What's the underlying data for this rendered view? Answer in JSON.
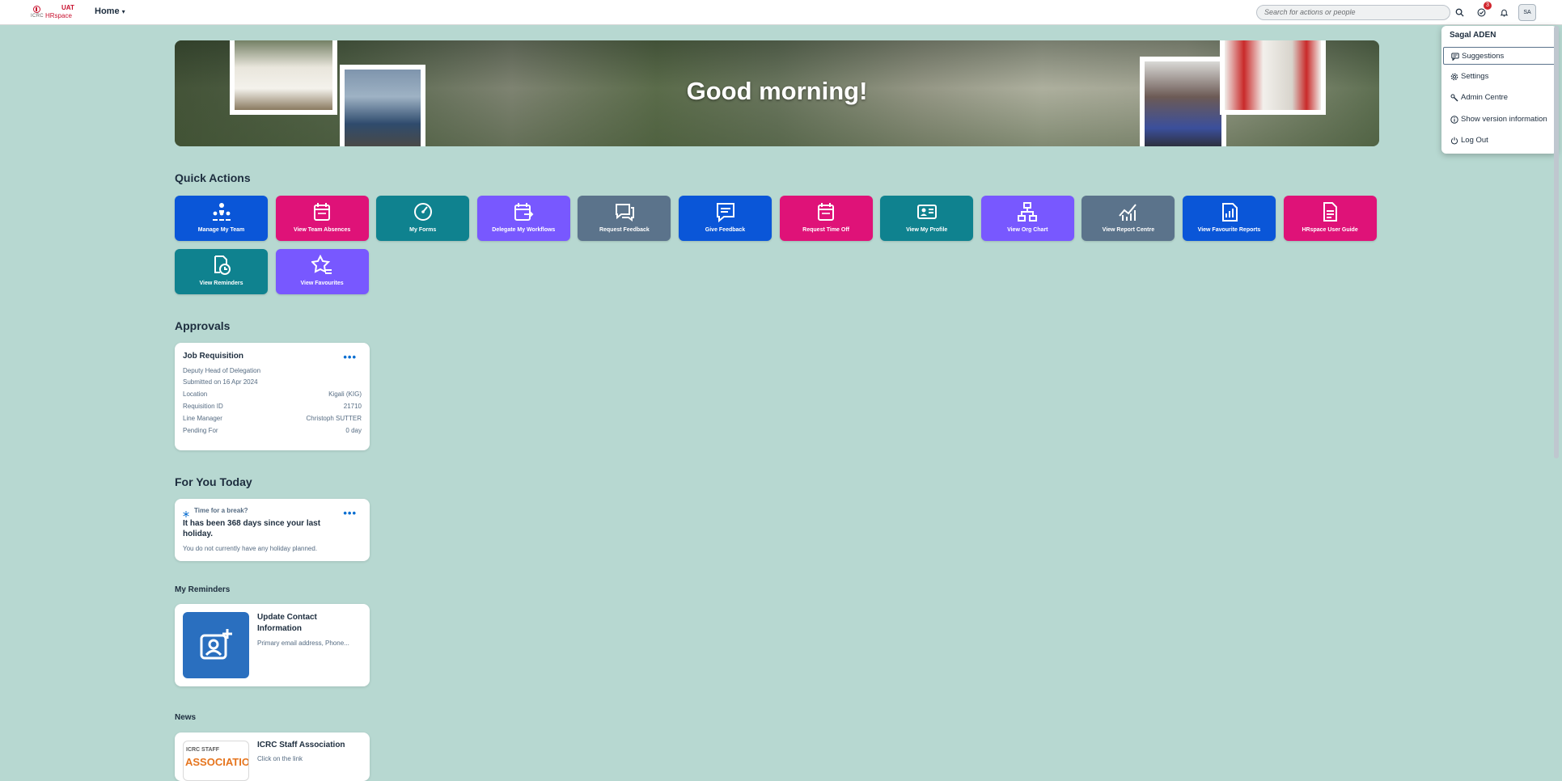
{
  "header": {
    "logo": {
      "org": "ICRC",
      "product": "HRspace",
      "env": "UAT"
    },
    "home_label": "Home",
    "search_placeholder": "Search for actions or people",
    "todo_count": "3",
    "avatar_initials": "SA"
  },
  "banner": {
    "greeting": "Good morning!"
  },
  "quick_actions": {
    "title": "Quick Actions",
    "tiles": [
      {
        "label": "Manage My Team",
        "icon": "org-team-icon",
        "color": "#0a56d8"
      },
      {
        "label": "View Team Absences",
        "icon": "calendar-icon",
        "color": "#df1278"
      },
      {
        "label": "My Forms",
        "icon": "gauge-icon",
        "color": "#0f828f"
      },
      {
        "label": "Delegate My Workflows",
        "icon": "calendar-arrow-icon",
        "color": "#7858ff"
      },
      {
        "label": "Request Feedback",
        "icon": "feedback-icon",
        "color": "#5b738b"
      },
      {
        "label": "Give Feedback",
        "icon": "message-icon",
        "color": "#0a56d8"
      },
      {
        "label": "Request Time Off",
        "icon": "calendar-icon",
        "color": "#df1278"
      },
      {
        "label": "View My Profile",
        "icon": "id-card-icon",
        "color": "#0f828f"
      },
      {
        "label": "View Org Chart",
        "icon": "org-chart-icon",
        "color": "#7858ff"
      },
      {
        "label": "View Report Centre",
        "icon": "line-chart-icon",
        "color": "#5b738b"
      },
      {
        "label": "View Favourite Reports",
        "icon": "report-icon",
        "color": "#0a56d8"
      },
      {
        "label": "HRspace User Guide",
        "icon": "document-icon",
        "color": "#df1278"
      },
      {
        "label": "View Reminders",
        "icon": "reminder-icon",
        "color": "#0f828f"
      },
      {
        "label": "View Favourites",
        "icon": "star-list-icon",
        "color": "#7858ff"
      }
    ]
  },
  "approvals": {
    "title": "Approvals",
    "card": {
      "title": "Job Requisition",
      "position": "Deputy Head of Delegation",
      "submitted": "Submitted on 16 Apr 2024",
      "rows": [
        {
          "label": "Location",
          "value": "Kigali (KIG)"
        },
        {
          "label": "Requisition ID",
          "value": "21710"
        },
        {
          "label": "Line Manager",
          "value": "Christoph SUTTER"
        },
        {
          "label": "Pending For",
          "value": "0 day"
        }
      ]
    }
  },
  "for_you_today": {
    "title": "For You Today",
    "card": {
      "kicker": "Time for a break?",
      "headline": "It has been 368 days since your last holiday.",
      "note": "You do not currently have any holiday planned."
    }
  },
  "reminders": {
    "title": "My Reminders",
    "card": {
      "title": "Update Contact Information",
      "subtitle": "Primary email address, Phone..."
    }
  },
  "news": {
    "title": "News",
    "card": {
      "title": "ICRC Staff Association",
      "subtitle": "Click on the link",
      "logo_text_top": "ICRC STAFF",
      "logo_text_bottom": "ASSOCIATION"
    }
  },
  "user_menu": {
    "user_name": "Sagal ADEN",
    "items": [
      {
        "label": "Suggestions",
        "icon": "suggestions-icon"
      },
      {
        "label": "Settings",
        "icon": "gear-icon"
      },
      {
        "label": "Admin Centre",
        "icon": "wrench-icon"
      },
      {
        "label": "Show version information",
        "icon": "info-icon"
      },
      {
        "label": "Log Out",
        "icon": "power-icon"
      }
    ]
  }
}
